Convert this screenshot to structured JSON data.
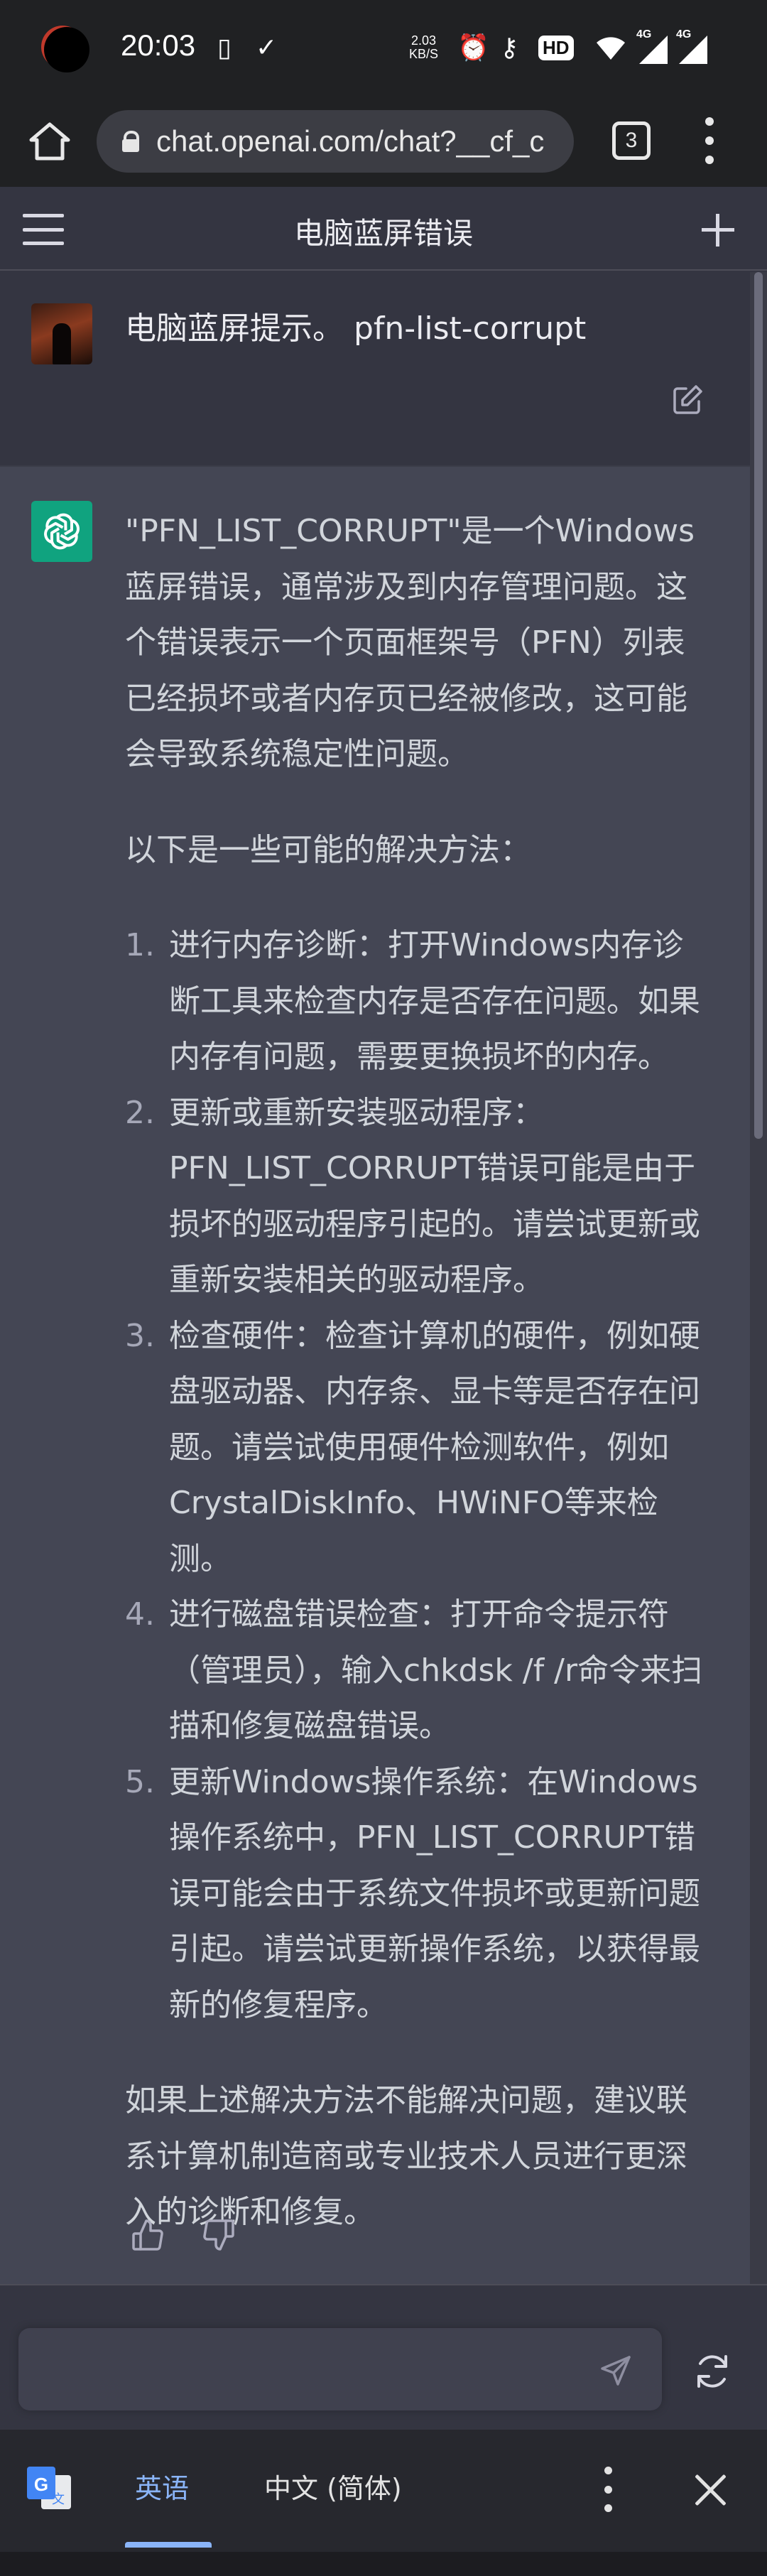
{
  "status_bar": {
    "time": "20:03",
    "net_speed_value": "2.03",
    "net_speed_unit": "KB/S",
    "hd_badge": "HD",
    "signal_1_label": "4G",
    "signal_2_label": "4G"
  },
  "browser": {
    "url": "chat.openai.com/chat?__cf_c",
    "tab_count": "3"
  },
  "chat": {
    "title": "电脑蓝屏错误"
  },
  "user_message": {
    "text": "电脑蓝屏提示。 pfn-list-corrupt"
  },
  "assistant_message": {
    "intro": "\"PFN_LIST_CORRUPT\"是一个Windows蓝屏错误，通常涉及到内存管理问题。这个错误表示一个页面框架号（PFN）列表已经损坏或者内存页已经被修改，这可能会导致系统稳定性问题。",
    "lead": "以下是一些可能的解决方法：",
    "steps": [
      {
        "num": "1.",
        "text": "进行内存诊断：打开Windows内存诊断工具来检查内存是否存在问题。如果内存有问题，需要更换损坏的内存。"
      },
      {
        "num": "2.",
        "text": "更新或重新安装驱动程序：PFN_LIST_CORRUPT错误可能是由于损坏的驱动程序引起的。请尝试更新或重新安装相关的驱动程序。"
      },
      {
        "num": "3.",
        "text": "检查硬件：检查计算机的硬件，例如硬盘驱动器、内存条、显卡等是否存在问题。请尝试使用硬件检测软件，例如CrystalDiskInfo、HWiNFO等来检测。"
      },
      {
        "num": "4.",
        "text": "进行磁盘错误检查：打开命令提示符（管理员），输入chkdsk /f /r命令来扫描和修复磁盘错误。"
      },
      {
        "num": "5.",
        "text": "更新Windows操作系统：在Windows操作系统中，PFN_LIST_CORRUPT错误可能会由于系统文件损坏或更新问题引起。请尝试更新操作系统，以获得最新的修复程序。"
      }
    ],
    "outro": "如果上述解决方法不能解决问题，建议联系计算机制造商或专业技术人员进行更深入的诊断和修复。"
  },
  "input": {
    "value": "",
    "placeholder": ""
  },
  "translate_bar": {
    "source_lang": "英语",
    "target_lang": "中文 (简体)"
  },
  "colors": {
    "page_bg": "#343541",
    "assistant_bg": "#444654",
    "openai_green": "#10a37f",
    "translate_accent": "#8ab4f8"
  }
}
